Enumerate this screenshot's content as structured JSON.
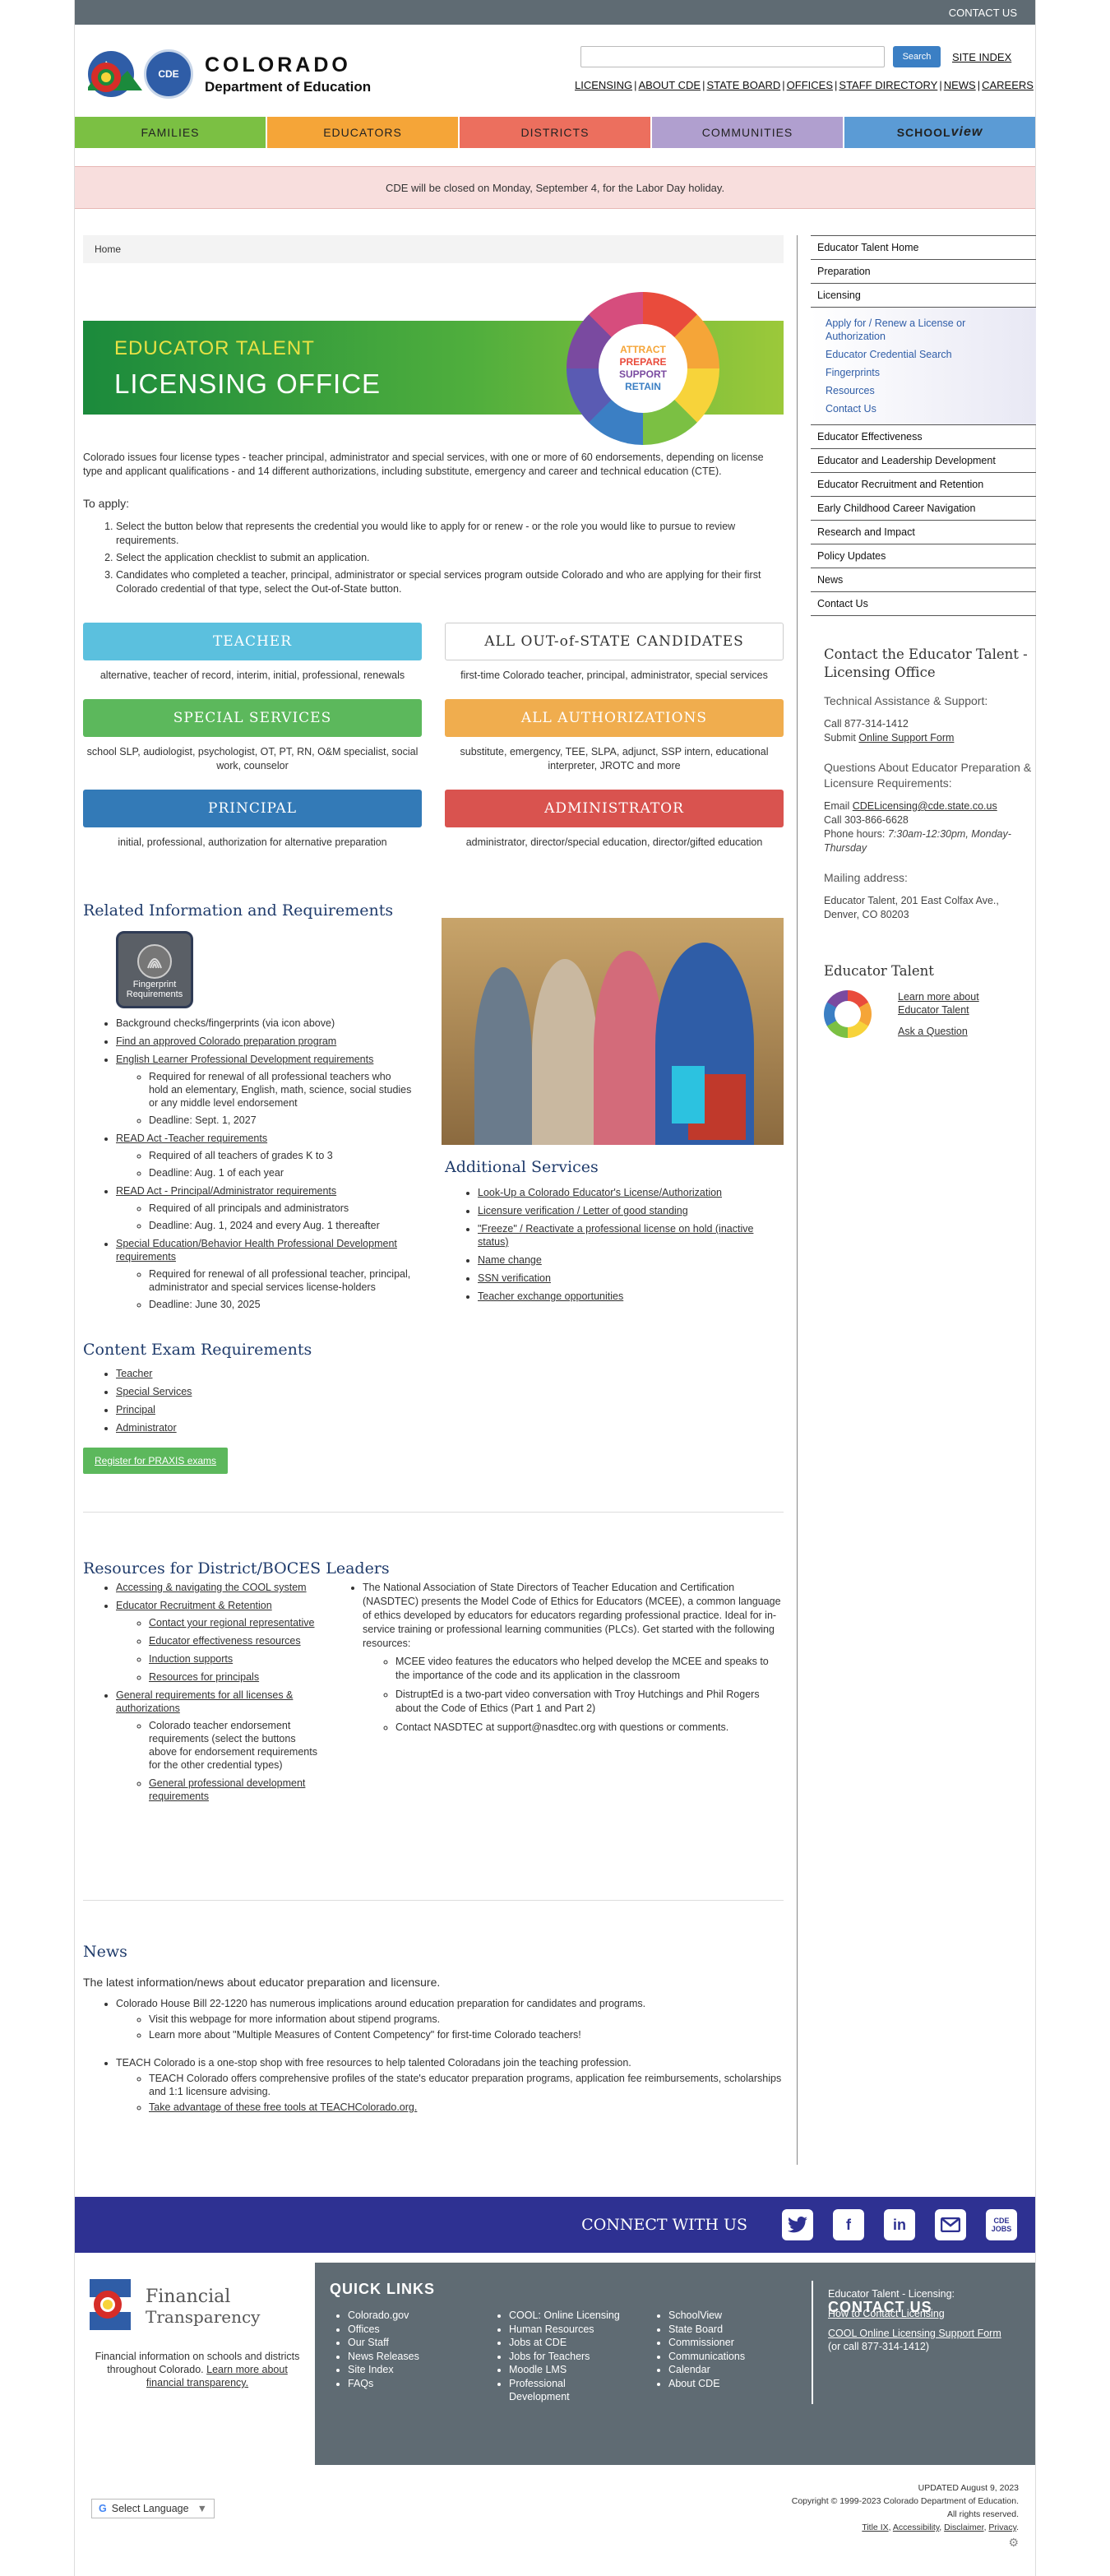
{
  "topbar": {
    "contact": "CONTACT US"
  },
  "header": {
    "logo_line1": "COLORADO",
    "logo_line2": "Department of Education",
    "search_button": "Search",
    "site_index": "SITE INDEX",
    "links": [
      "LICENSING",
      "ABOUT CDE",
      "STATE BOARD",
      "OFFICES",
      "STAFF DIRECTORY",
      "NEWS",
      "CAREERS"
    ]
  },
  "nav": {
    "families": "FAMILIES",
    "educators": "EDUCATORS",
    "districts": "DISTRICTS",
    "communities": "COMMUNITIES",
    "schoolview_a": "SCHOOL",
    "schoolview_b": "view"
  },
  "alert": "CDE will be closed on Monday, September 4, for the Labor Day holiday.",
  "breadcrumb": "Home",
  "banner": {
    "line1": "EDUCATOR TALENT",
    "line2": "LICENSING OFFICE",
    "wheel": [
      "ATTRACT",
      "PREPARE",
      "SUPPORT",
      "RETAIN"
    ]
  },
  "intro": "Colorado issues four license types - teacher principal, administrator and special services, with one or more of 60 endorsements, depending on license type and applicant qualifications - and 14 different authorizations, including substitute, emergency and career and technical education (CTE).",
  "to_apply": "To apply:",
  "steps": [
    "Select the button below that represents the credential you would like to apply for or renew - or the role you would like to pursue to review requirements.",
    "Select the application checklist to submit an application.",
    "Candidates who completed a teacher, principal, administrator or special services program outside Colorado and who are applying for their first Colorado credential of that type, select the Out-of-State button."
  ],
  "credentials": [
    {
      "label": "TEACHER",
      "desc": "alternative, teacher of record, interim, initial, professional, renewals",
      "color": "#5bc0de"
    },
    {
      "label": "ALL OUT-of-STATE CANDIDATES",
      "desc": "first-time Colorado teacher, principal, administrator, special services",
      "color": "#ffffff"
    },
    {
      "label": "SPECIAL SERVICES",
      "desc": "school SLP, audiologist, psychologist, OT, PT, RN, O&M specialist, social work, counselor",
      "color": "#5cb85c"
    },
    {
      "label": "ALL  AUTHORIZATIONS",
      "desc": "substitute, emergency, TEE, SLPA, adjunct, SSP intern, educational interpreter, JROTC and more",
      "color": "#f0ad4e"
    },
    {
      "label": "PRINCIPAL",
      "desc": "initial, professional, authorization for alternative preparation",
      "color": "#337ab7"
    },
    {
      "label": "ADMINISTRATOR",
      "desc": "administrator, director/special education, director/gifted education",
      "color": "#d9534f"
    }
  ],
  "related": {
    "title": "Related Information and Requirements",
    "fp_label": "Fingerprint Requirements",
    "items": [
      {
        "text": "Background checks/fingerprints (via icon above)",
        "sub": []
      },
      {
        "text": "Find an approved Colorado preparation program",
        "sub": []
      },
      {
        "text": "English Learner Professional Development requirements",
        "sub": [
          "Required for renewal of all professional teachers who hold an elementary, English, math, science, social studies or any middle level endorsement",
          "Deadline: Sept. 1, 2027"
        ]
      },
      {
        "text": "READ Act -Teacher requirements",
        "sub": [
          "Required of all teachers of grades K to 3",
          "Deadline: Aug. 1 of each year"
        ]
      },
      {
        "text": "READ Act - Principal/Administrator requirements",
        "sub": [
          "Required of all principals and administrators",
          "Deadline: Aug. 1, 2024 and every Aug. 1 thereafter"
        ]
      },
      {
        "text": "Special Education/Behavior Health Professional Development requirements",
        "sub": [
          "Required for renewal of all professional teacher, principal, administrator and special services license-holders",
          "Deadline: June 30, 2025"
        ]
      }
    ]
  },
  "additional": {
    "title": "Additional Services",
    "items": [
      "Look-Up a Colorado Educator's License/Authorization",
      "Licensure verification / Letter of good standing",
      "\"Freeze\" / Reactivate a professional license on hold (inactive status)",
      "Name change",
      "SSN verification",
      "Teacher exchange opportunities"
    ]
  },
  "content_exam": {
    "title": "Content Exam Requirements",
    "items": [
      "Teacher",
      "Special Services",
      "Principal",
      "Administrator"
    ],
    "button": "Register for PRAXIS exams"
  },
  "resources": {
    "title": "Resources for District/BOCES Leaders",
    "col1": [
      {
        "text": "Accessing & navigating the COOL system",
        "sub": []
      },
      {
        "text": "Educator Recruitment & Retention",
        "sub": [
          "Contact your regional representative",
          "Educator effectiveness resources",
          "Induction supports",
          "Resources for principals"
        ]
      },
      {
        "text": "General requirements for all licenses & authorizations",
        "sub": [
          "Colorado teacher endorsement requirements (select the buttons above for endorsement requirements for the other credential types)",
          "General professional development requirements"
        ]
      }
    ],
    "col2_main": "The National Association of State Directors of Teacher Education and Certification (NASDTEC) presents the Model Code of Ethics for Educators (MCEE), a common language of ethics developed by educators for educators regarding professional practice. Ideal for in-service training or professional learning communities (PLCs). Get started with the following resources:",
    "col2_sub": [
      "MCEE video features the educators who helped develop the MCEE and speaks to the importance of the code and its application in the classroom",
      "DistruptEd is a two-part video conversation with Troy Hutchings and Phil Rogers about the Code of Ethics (Part 1 and Part 2)",
      "Contact NASDTEC at support@nasdtec.org with questions or comments."
    ]
  },
  "news": {
    "title": "News",
    "intro": "The latest information/news about educator preparation and licensure.",
    "items": [
      {
        "text": "Colorado House Bill 22-1220 has numerous implications around education preparation for candidates and programs.",
        "sub": [
          "Visit this webpage for more information about stipend programs.",
          "Learn more about \"Multiple Measures of Content Competency\" for first-time Colorado teachers!"
        ]
      },
      {
        "text": "TEACH Colorado is a one-stop shop with free resources to help talented Coloradans join the teaching profession.",
        "sub": [
          "TEACH Colorado offers comprehensive profiles of the state's educator preparation programs, application fee reimbursements, scholarships and 1:1 licensure advising.",
          "Take advantage of these free tools at TEACHColorado.org."
        ]
      }
    ]
  },
  "sidebar": {
    "top": [
      "Educator Talent Home",
      "Preparation",
      "Licensing"
    ],
    "sub": [
      "Apply for / Renew a License or Authorization",
      "Educator Credential Search",
      "Fingerprints",
      "Resources",
      "Contact Us"
    ],
    "bottom": [
      "Educator Effectiveness",
      "Educator and Leadership Development",
      "Educator Recruitment and Retention",
      "Early Childhood Career Navigation",
      "Research and Impact",
      "Policy Updates",
      "News",
      "Contact Us"
    ],
    "contact_title": "Contact the Educator Talent - Licensing Office",
    "tech_label": "Technical Assistance & Support:",
    "tech_phone": "Call 877-314-1412",
    "tech_submit_prefix": "Submit ",
    "tech_submit_link": "Online Support Form",
    "q_label": "Questions About Educator Preparation & Licensure Requirements:",
    "email_prefix": "Email ",
    "email": "CDELicensing@cde.state.co.us",
    "phone": "Call 303-866-6628",
    "hours_prefix": "Phone hours: ",
    "hours": "7:30am-12:30pm, Monday-Thursday",
    "mail_label": "Mailing address:",
    "mail": "Educator Talent, 201 East Colfax Ave., Denver, CO 80203",
    "et_title": "Educator Talent",
    "et_link1": "Learn more about Educator Talent",
    "et_link2": "Ask a Question"
  },
  "footer": {
    "connect": "CONNECT WITH US",
    "ft_name1": "Financial",
    "ft_name2": "Transparency",
    "ft_text": "Financial information on schools and districts throughout Colorado.",
    "ft_link": "Learn more about financial transparency.",
    "quick_title": "QUICK LINKS",
    "q1": [
      "Colorado.gov",
      "Offices",
      "Our Staff",
      "News Releases",
      "Site Index",
      "FAQs"
    ],
    "q2": [
      "COOL: Online Licensing",
      "Human Resources",
      "Jobs at CDE",
      "Jobs for Teachers",
      "Moodle LMS",
      "Professional Development"
    ],
    "q3": [
      "SchoolView",
      "State Board",
      "Commissioner",
      "Communications",
      "Calendar",
      "About CDE"
    ],
    "contact_title": "CONTACT US",
    "contact_sub": "Educator Talent - Licensing:",
    "contact_link1": "How to Contact Licensing",
    "contact_link2": "COOL Online Licensing Support Form",
    "contact_phone": "(or call 877-314-1412)",
    "lang": "Select Language",
    "updated": "UPDATED August 9, 2023",
    "copyright": "Copyright © 1999-2023 Colorado Department of Education.",
    "rights": "All rights reserved.",
    "legal": [
      "Title IX",
      "Accessibility",
      "Disclaimer",
      "Privacy"
    ]
  }
}
